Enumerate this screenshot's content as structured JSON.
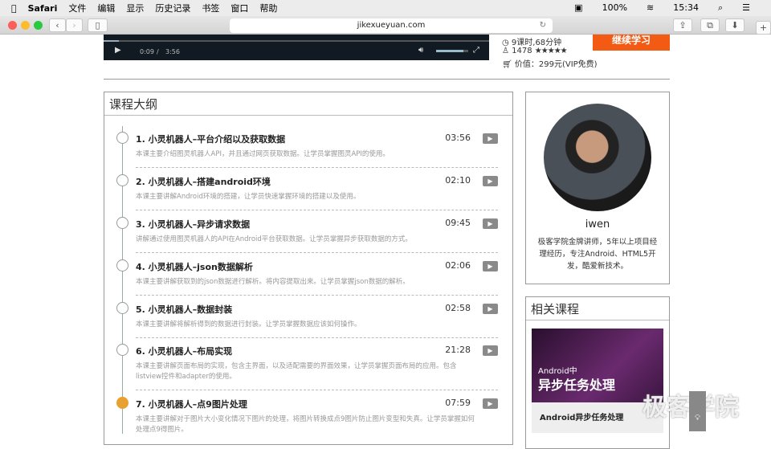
{
  "menubar": {
    "apple": "",
    "app": "Safari",
    "items": [
      "文件",
      "编辑",
      "显示",
      "历史记录",
      "书签",
      "窗口",
      "帮助"
    ],
    "battery": "100%",
    "time": "15:34"
  },
  "browser": {
    "url": "jikexueyuan.com"
  },
  "video": {
    "current": "0:09",
    "separator": "/",
    "duration": "3:56",
    "volume": 0.85,
    "progress": 0.04
  },
  "course_info": {
    "duration": "9课时,68分钟",
    "students": "1478",
    "rating": 5,
    "stars": "★★★★★",
    "price": "价值：299元(VIP免费)",
    "cta": "继续学习"
  },
  "outline": {
    "title": "课程大纲",
    "items": [
      {
        "title": "1. 小灵机器人–平台介绍以及获取数据",
        "duration": "03:56",
        "desc": "本课主要介绍图灵机器人API，并且通过网页获取数据。让学员掌握图灵API的使用。",
        "active": false
      },
      {
        "title": "2. 小灵机器人–搭建android环境",
        "duration": "02:10",
        "desc": "本课主要讲解Android环境的搭建，让学员快速掌握环境的搭建以及使用。",
        "active": false
      },
      {
        "title": "3. 小灵机器人–异步请求数据",
        "duration": "09:45",
        "desc": "讲解通过使用图灵机器人的API在Android平台获取数据。让学员掌握异步获取数据的方式。",
        "active": false
      },
      {
        "title": "4. 小灵机器人–json数据解析",
        "duration": "02:06",
        "desc": "本课主要讲解获取到的json数据进行解析。将内容提取出来。让学员掌握json数据的解析。",
        "active": false
      },
      {
        "title": "5. 小灵机器人–数据封装",
        "duration": "02:58",
        "desc": "本课主要讲解将解析得到的数据进行封装。让学员掌握数据应该如何操作。",
        "active": false
      },
      {
        "title": "6. 小灵机器人–布局实现",
        "duration": "21:28",
        "desc": "本课主要讲解页面布局的实现，包含主界面，以及适配需要的界面效果，让学员掌握页面布局的应用。包含listview控件和adapter的使用。",
        "active": false
      },
      {
        "title": "7. 小灵机器人–点9图片处理",
        "duration": "07:59",
        "desc": "本课主要讲解对于图片大小变化情况下图片的处理，将图片转换成点9图片防止图片变型和失真。让学员掌握如何处理点9得图片。",
        "active": true
      }
    ]
  },
  "teacher": {
    "name": "iwen",
    "bio": "极客学院金牌讲师，5年以上项目经理经历，专注Android、HTML5开发，酷爱新技术。"
  },
  "related": {
    "title": "相关课程",
    "course": {
      "image_subtitle": "Android中",
      "image_title": "异步任务处理",
      "title": "Android异步任务处理"
    }
  },
  "watermark": "极客学院",
  "colors": {
    "accent": "#f35a13",
    "active_lesson": "#e8a030"
  }
}
